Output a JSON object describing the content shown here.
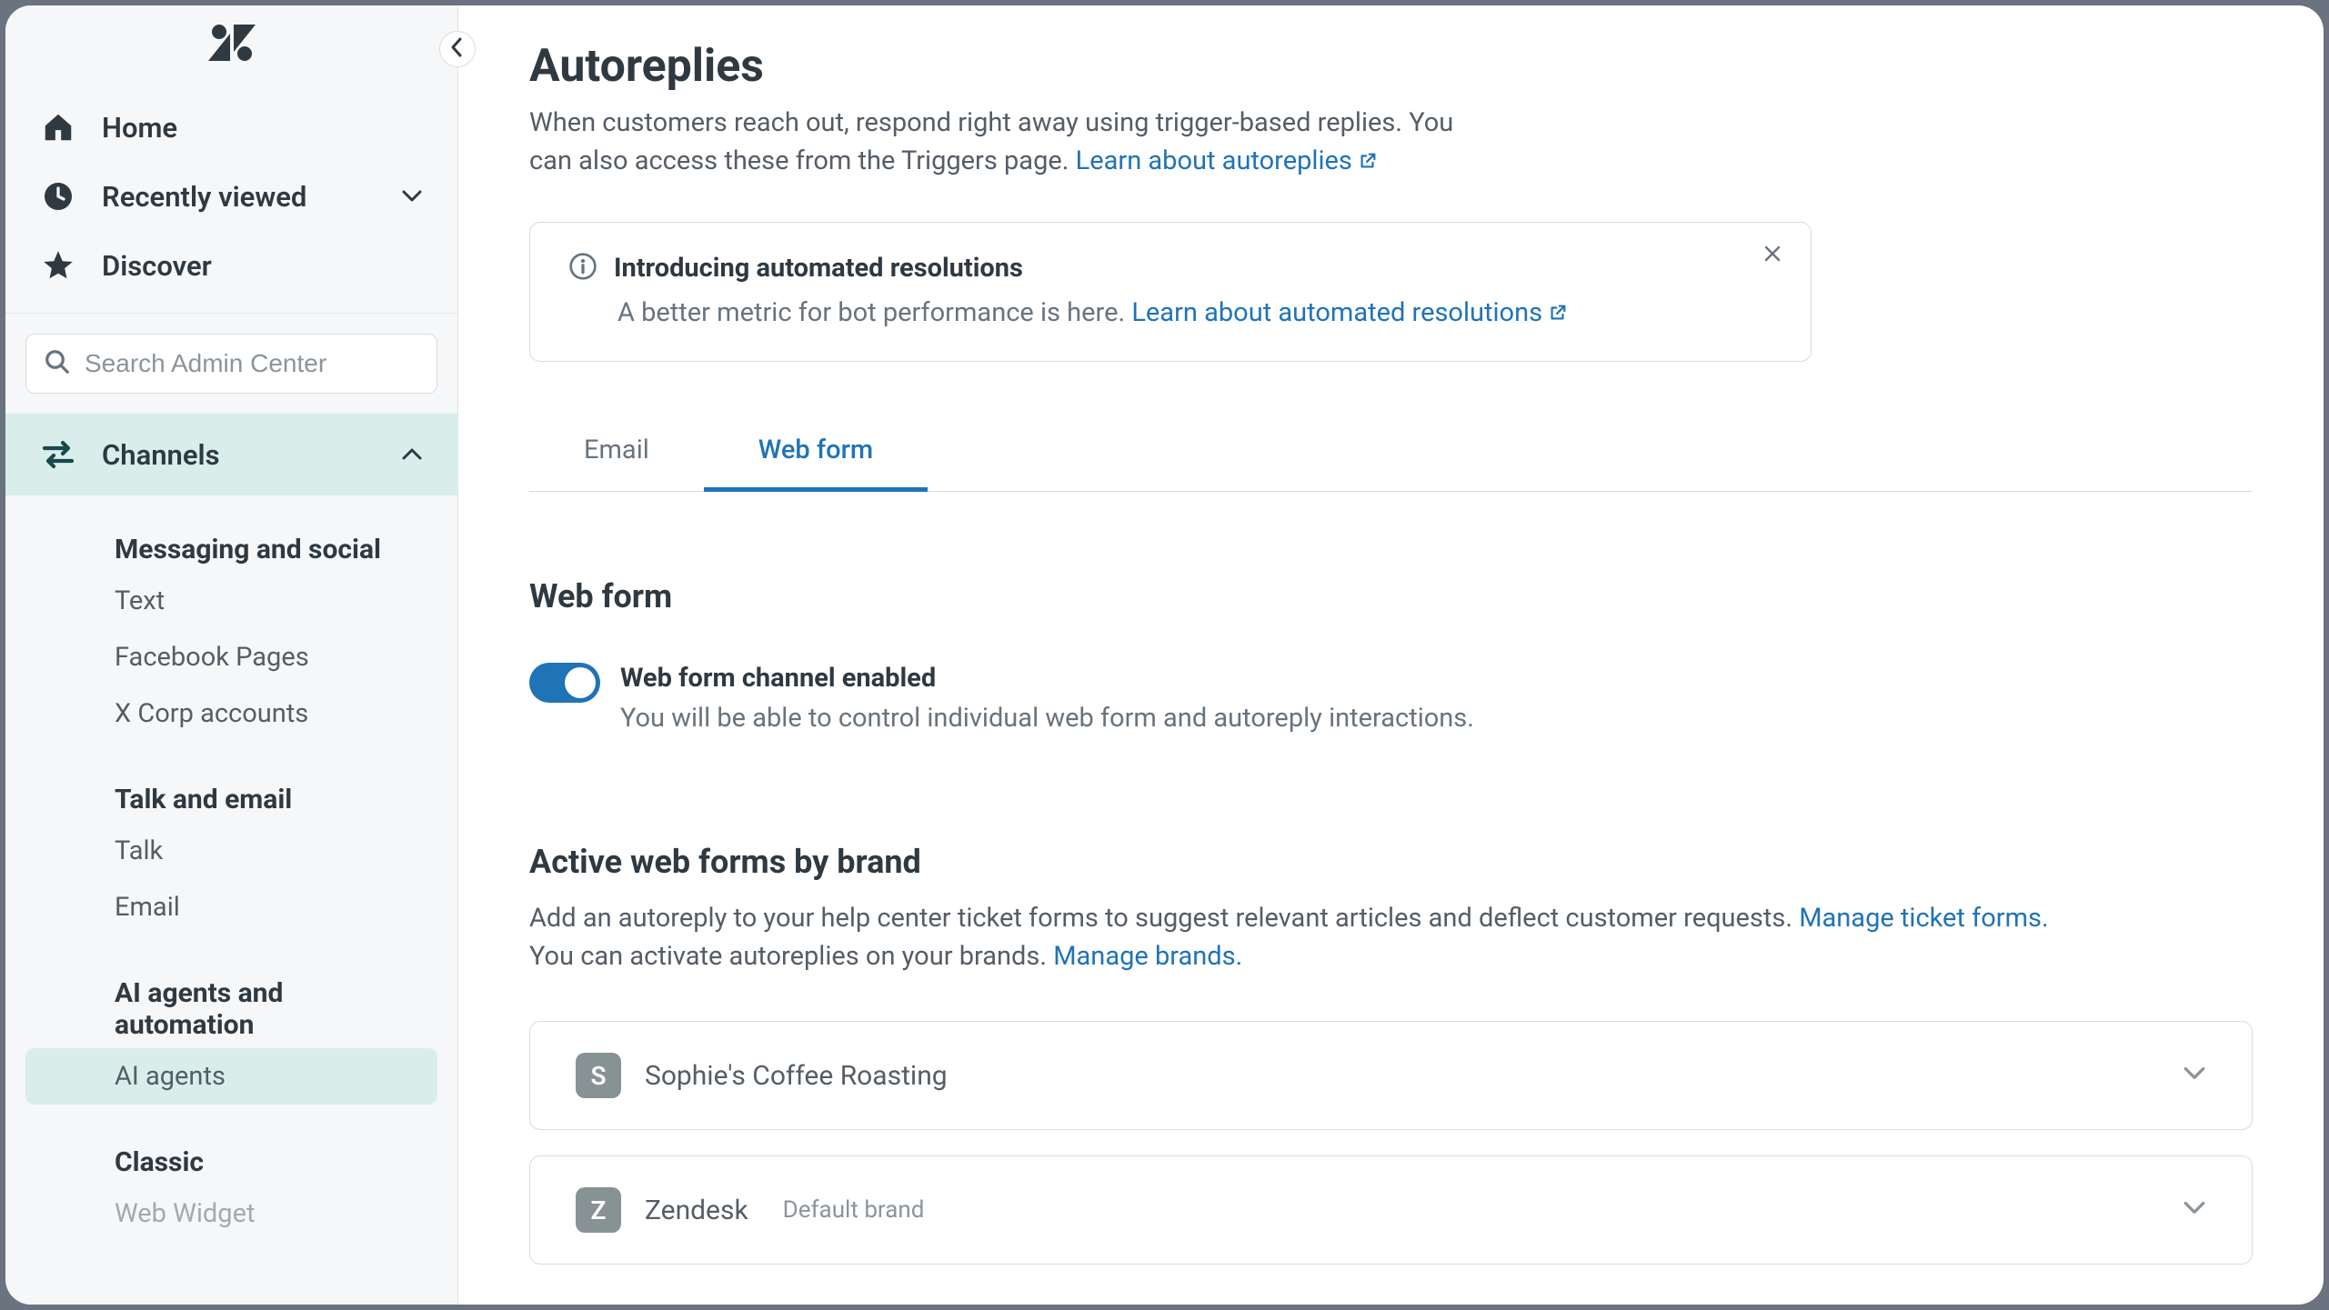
{
  "sidebar": {
    "primary": {
      "home": "Home",
      "recently_viewed": "Recently viewed",
      "discover": "Discover"
    },
    "search_placeholder": "Search Admin Center",
    "channels_label": "Channels",
    "groups": [
      {
        "title": "Messaging and social",
        "items": [
          "Text",
          "Facebook Pages",
          "X Corp accounts"
        ]
      },
      {
        "title": "Talk and email",
        "items": [
          "Talk",
          "Email"
        ]
      },
      {
        "title": "AI agents and automation",
        "items": [
          "AI agents"
        ],
        "active_index": 0
      },
      {
        "title": "Classic",
        "items": [
          "Web Widget"
        ]
      }
    ]
  },
  "page": {
    "title": "Autoreplies",
    "description": "When customers reach out, respond right away using trigger-based replies. You can also access these from the Triggers page.",
    "learn_link": "Learn about autoreplies"
  },
  "alert": {
    "title": "Introducing automated resolutions",
    "body": "A better metric for bot performance is here.",
    "link": "Learn about automated resolutions"
  },
  "tabs": {
    "email": "Email",
    "webform": "Web form",
    "active": "webform"
  },
  "webform": {
    "section_title": "Web form",
    "toggle_on": true,
    "toggle_title": "Web form channel enabled",
    "toggle_body": "You will be able to control individual web form and autoreply interactions."
  },
  "brands_section": {
    "title": "Active web forms by brand",
    "p1": "Add an autoreply to your help center ticket forms to suggest relevant articles and deflect customer requests.",
    "link1": "Manage ticket forms.",
    "p2": "You can activate autoreplies on your brands.",
    "link2": "Manage brands."
  },
  "brands": [
    {
      "initial": "S",
      "name": "Sophie's Coffee Roasting",
      "badge_color": "#879294",
      "tag": ""
    },
    {
      "initial": "Z",
      "name": "Zendesk",
      "badge_color": "#879294",
      "tag": "Default brand"
    }
  ]
}
